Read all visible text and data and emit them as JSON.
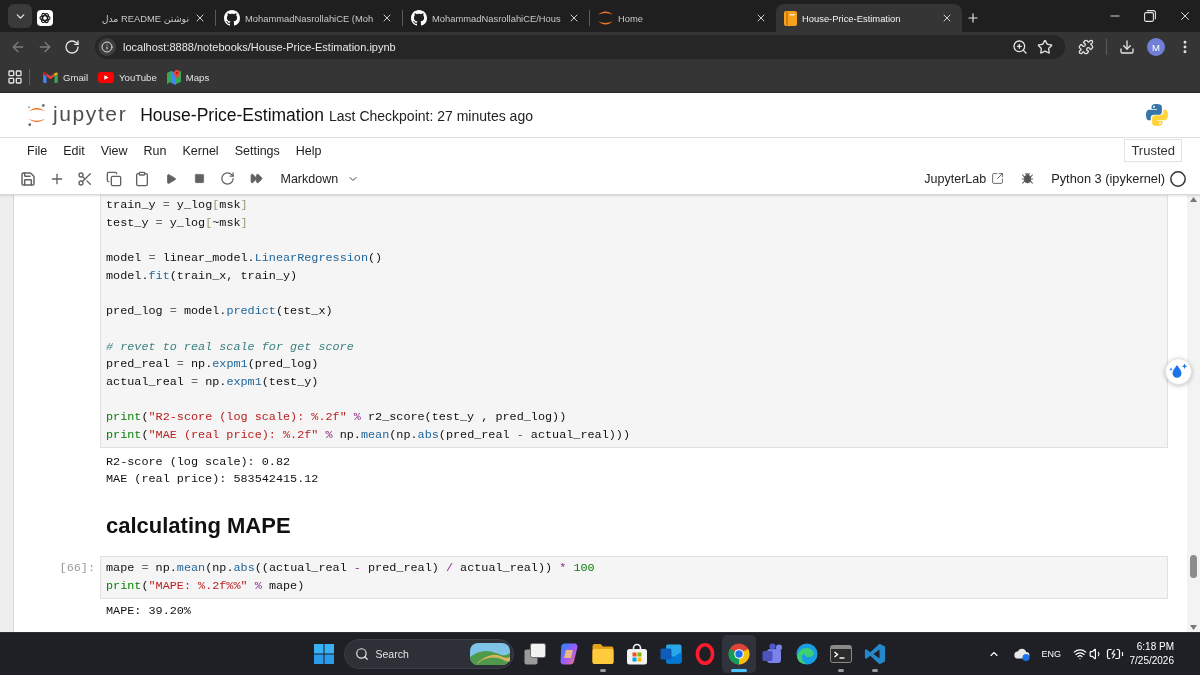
{
  "browser": {
    "tabs": [
      {
        "kind": "pinned",
        "selected": false
      },
      {
        "kind": "plain",
        "title": "نوشتن README مدل",
        "selected": false
      },
      {
        "kind": "github",
        "title": "MohammadNasrollahiCE (Moh",
        "selected": false
      },
      {
        "kind": "github",
        "title": "MohammadNasrollahiCE/Hous",
        "selected": false
      },
      {
        "kind": "jupyter",
        "title": "Home",
        "selected": false
      },
      {
        "kind": "notebook",
        "title": "House-Price-Estimation",
        "selected": true
      }
    ],
    "back_disabled": true,
    "forward_disabled": true,
    "url": "localhost:8888/notebooks/House-Price-Estimation.ipynb",
    "profile_initial": "M",
    "bookmarks": [
      {
        "kind": "gmail",
        "label": "Gmail"
      },
      {
        "kind": "youtube",
        "label": "YouTube"
      },
      {
        "kind": "maps",
        "label": "Maps"
      }
    ]
  },
  "notebook": {
    "logo_text": "jupyter",
    "title": "House-Price-Estimation",
    "checkpoint": "Last Checkpoint: 27 minutes ago",
    "menu": [
      "File",
      "Edit",
      "View",
      "Run",
      "Kernel",
      "Settings",
      "Help"
    ],
    "trusted": "Trusted",
    "cell_type": "Markdown",
    "lab_link": "JupyterLab",
    "kernel": "Python 3 (ipykernel)",
    "kernel_busy": false,
    "cells": [
      {
        "kind": "code",
        "blocks": [
          [
            [
              {
                "kind": "name",
                "text": "train_y"
              },
              {
                "kind": "assign",
                "text": " = "
              },
              {
                "kind": "name",
                "text": "y_log"
              },
              {
                "kind": "bracket",
                "text": "["
              },
              {
                "kind": "name",
                "text": "msk"
              },
              {
                "kind": "bracket",
                "text": "]"
              }
            ],
            [
              {
                "kind": "name",
                "text": "test_y"
              },
              {
                "kind": "assign",
                "text": " = "
              },
              {
                "kind": "name",
                "text": "y_log"
              },
              {
                "kind": "bracket",
                "text": "["
              },
              {
                "kind": "name",
                "text": "~msk"
              },
              {
                "kind": "bracket",
                "text": "]"
              }
            ]
          ],
          [
            [
              {
                "kind": "name",
                "text": "model"
              },
              {
                "kind": "assign",
                "text": " = "
              },
              {
                "kind": "name",
                "text": "linear_model."
              },
              {
                "kind": "func",
                "text": "LinearRegression"
              },
              {
                "kind": "name",
                "text": "()"
              }
            ],
            [
              {
                "kind": "name",
                "text": "model."
              },
              {
                "kind": "func",
                "text": "fit"
              },
              {
                "kind": "name",
                "text": "(train_x, train_y)"
              }
            ]
          ],
          [
            [
              {
                "kind": "name",
                "text": "pred_log"
              },
              {
                "kind": "assign",
                "text": " = "
              },
              {
                "kind": "name",
                "text": "model."
              },
              {
                "kind": "func",
                "text": "predict"
              },
              {
                "kind": "name",
                "text": "(test_x)"
              }
            ]
          ],
          [
            [
              {
                "kind": "comment",
                "text": "# revet to real scale for get score"
              }
            ],
            [
              {
                "kind": "name",
                "text": "pred_real"
              },
              {
                "kind": "assign",
                "text": " = "
              },
              {
                "kind": "name",
                "text": "np."
              },
              {
                "kind": "func",
                "text": "expm1"
              },
              {
                "kind": "name",
                "text": "(pred_log)"
              }
            ],
            [
              {
                "kind": "name",
                "text": "actual_real"
              },
              {
                "kind": "assign",
                "text": " = "
              },
              {
                "kind": "name",
                "text": "np."
              },
              {
                "kind": "func",
                "text": "expm1"
              },
              {
                "kind": "name",
                "text": "(test_y)"
              }
            ]
          ],
          [
            [
              {
                "kind": "builtin",
                "text": "print"
              },
              {
                "kind": "name",
                "text": "("
              },
              {
                "kind": "string",
                "text": "\"R2-score (log scale): %.2f\""
              },
              {
                "kind": "op",
                "text": " % "
              },
              {
                "kind": "name",
                "text": "r2_score(test_y , pred_log))"
              }
            ],
            [
              {
                "kind": "builtin",
                "text": "print"
              },
              {
                "kind": "name",
                "text": "("
              },
              {
                "kind": "string",
                "text": "\"MAE (real price): %.2f\""
              },
              {
                "kind": "op",
                "text": " % "
              },
              {
                "kind": "name",
                "text": "np."
              },
              {
                "kind": "func",
                "text": "mean"
              },
              {
                "kind": "name",
                "text": "(np."
              },
              {
                "kind": "func",
                "text": "abs"
              },
              {
                "kind": "name",
                "text": "(pred_real "
              },
              {
                "kind": "op",
                "text": "-"
              },
              {
                "kind": "name",
                "text": " actual_real)))"
              }
            ]
          ]
        ]
      },
      {
        "kind": "output",
        "lines": [
          "R2-score (log scale): 0.82",
          "MAE (real price): 583542415.12"
        ]
      },
      {
        "kind": "heading",
        "text": "calculating MAPE"
      },
      {
        "kind": "code",
        "prompt": "[66]:",
        "blocks": [
          [
            [
              {
                "kind": "name",
                "text": "mape"
              },
              {
                "kind": "assign",
                "text": " = "
              },
              {
                "kind": "name",
                "text": "np."
              },
              {
                "kind": "func",
                "text": "mean"
              },
              {
                "kind": "name",
                "text": "(np."
              },
              {
                "kind": "func",
                "text": "abs"
              },
              {
                "kind": "name",
                "text": "((actual_real "
              },
              {
                "kind": "op",
                "text": "-"
              },
              {
                "kind": "name",
                "text": " pred_real) "
              },
              {
                "kind": "op",
                "text": "/"
              },
              {
                "kind": "name",
                "text": " actual_real)) "
              },
              {
                "kind": "op",
                "text": "* "
              },
              {
                "kind": "number",
                "text": "100"
              }
            ],
            [
              {
                "kind": "builtin",
                "text": "print"
              },
              {
                "kind": "name",
                "text": "("
              },
              {
                "kind": "string",
                "text": "\"MAPE: %.2f%%\""
              },
              {
                "kind": "op",
                "text": " % "
              },
              {
                "kind": "name",
                "text": "mape)"
              }
            ]
          ]
        ]
      },
      {
        "kind": "output",
        "lines": [
          "MAPE: 39.20%"
        ]
      }
    ]
  },
  "taskbar": {
    "search": {
      "placeholder": "Search"
    },
    "apps": [
      {
        "kind": "task-view",
        "running": false,
        "selected": false
      },
      {
        "kind": "copilot",
        "running": false,
        "selected": false
      },
      {
        "kind": "files",
        "running": true,
        "selected": false
      },
      {
        "kind": "store",
        "running": false,
        "selected": false
      },
      {
        "kind": "mail",
        "running": false,
        "selected": false
      },
      {
        "kind": "opera",
        "running": false,
        "selected": false
      },
      {
        "kind": "chrome",
        "running": true,
        "selected": true
      },
      {
        "kind": "teams",
        "running": false,
        "selected": false
      },
      {
        "kind": "edge",
        "running": false,
        "selected": false
      },
      {
        "kind": "terminal",
        "running": true,
        "selected": false
      },
      {
        "kind": "vscode",
        "running": true,
        "selected": false
      }
    ],
    "language": "ENG",
    "time": "6:18 PM",
    "date": "7/25/2026"
  }
}
